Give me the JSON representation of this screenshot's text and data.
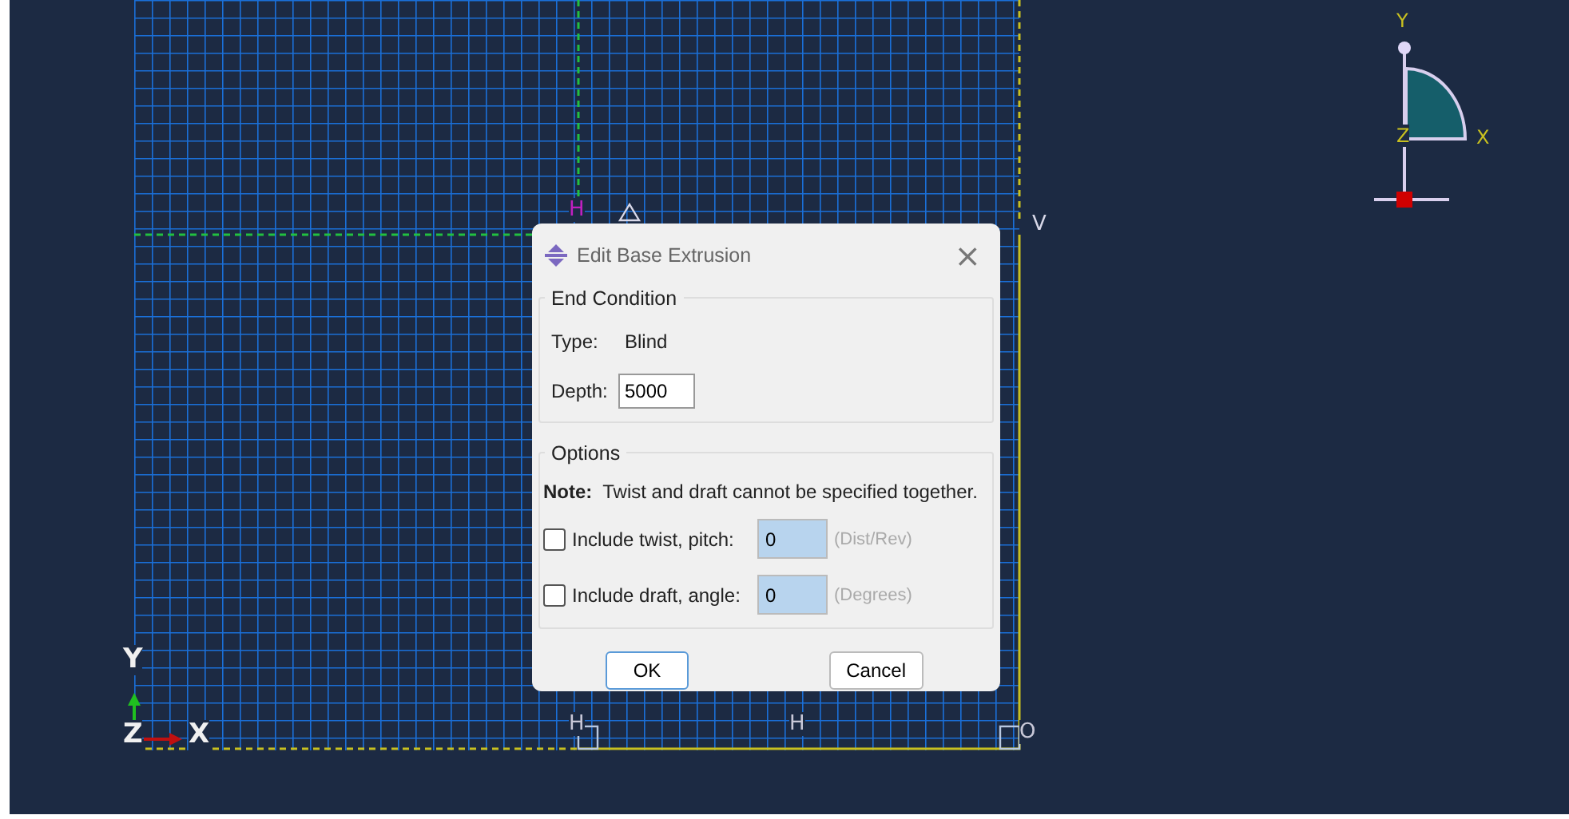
{
  "viewport": {
    "sketch_labels": [
      "H",
      "V",
      "H",
      "H",
      "O"
    ],
    "triad_labels": [
      "Y",
      "X",
      "Z"
    ],
    "axis_labels": [
      "Y",
      "Z",
      "X"
    ]
  },
  "dialog": {
    "title": "Edit Base Extrusion",
    "close": "×",
    "end_condition": {
      "legend": "End Condition",
      "type_label": "Type:",
      "type_value": "Blind",
      "depth_label": "Depth:",
      "depth_value": "5000"
    },
    "options": {
      "legend": "Options",
      "note_label": "Note:",
      "note_text": "Twist and draft cannot be specified together.",
      "rows": [
        {
          "label": "Include twist, pitch:",
          "checked": false,
          "value": "0",
          "unit": "(Dist/Rev)",
          "disabled": true
        },
        {
          "label": "Include draft, angle:",
          "checked": false,
          "value": "0",
          "unit": "(Degrees)",
          "disabled": true
        }
      ]
    },
    "buttons": [
      {
        "label": "OK",
        "selected": true
      },
      {
        "label": "Cancel",
        "selected": false
      }
    ]
  }
}
